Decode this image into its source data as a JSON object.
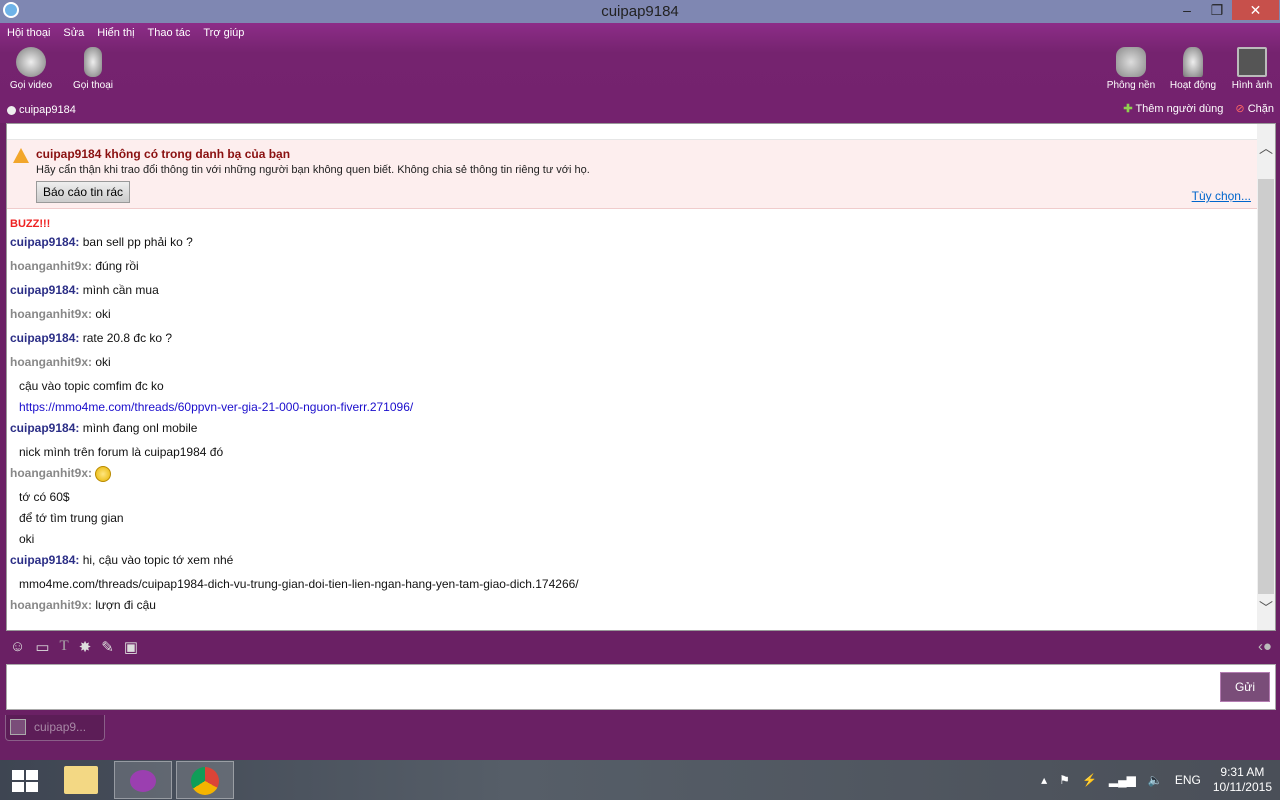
{
  "window": {
    "title": "cuipap9184",
    "min": "–",
    "max": "❐",
    "close": "✕"
  },
  "menu": [
    "Hội thoại",
    "Sửa",
    "Hiển thị",
    "Thao tác",
    "Trợ giúp"
  ],
  "toolbar": {
    "video": "Gọi video",
    "voice": "Gọi thoại",
    "background": "Phông nền",
    "activity": "Hoạt động",
    "photos": "Hình ảnh"
  },
  "contact": {
    "name": "cuipap9184",
    "add_user": "Thêm người dùng",
    "block": "Chặn"
  },
  "warning": {
    "title": "cuipap9184 không có trong danh bạ của bạn",
    "body": "Hãy cẩn thận khi trao đổi thông tin với những người bạn không quen biết. Không chia sẻ thông tin riêng tư với họ.",
    "report": "Báo cáo tin rác",
    "options": "Tùy chọn..."
  },
  "buzz": "BUZZ!!!",
  "messages": [
    {
      "sender": "cuipap9184:",
      "text": "ban sell pp phải ko ?"
    },
    {
      "sender": "hoanganhit9x:",
      "text": "đúng rồi"
    },
    {
      "sender": "cuipap9184:",
      "text": "mình cần mua"
    },
    {
      "sender": "hoanganhit9x:",
      "text": "oki"
    },
    {
      "sender": "cuipap9184:",
      "text": "rate 20.8 đc ko ?"
    },
    {
      "sender": "hoanganhit9x:",
      "text": "oki"
    },
    {
      "text": "cậu vào topic comfim đc ko"
    },
    {
      "link": "https://mmo4me.com/threads/60ppvn-ver-gia-21-000-nguon-fiverr.271096/"
    },
    {
      "sender": "cuipap9184:",
      "text": "mình đang onl mobile"
    },
    {
      "text": "nick mình trên forum là cuipap1984 đó"
    },
    {
      "sender": "hoanganhit9x:",
      "text": ""
    },
    {
      "text": "tớ có 60$"
    },
    {
      "text": "để tớ tìm trung gian"
    },
    {
      "text": "oki"
    },
    {
      "sender": "cuipap9184:",
      "text": "hi, cậu vào topic tớ xem nhé"
    },
    {
      "text": "mmo4me.com/threads/cuipap1984-dich-vu-trung-gian-doi-tien-lien-ngan-hang-yen-tam-giao-dich.174266/"
    },
    {
      "sender": "hoanganhit9x:",
      "text": "lượn đi cậu"
    }
  ],
  "composer": {
    "send": "Gửi",
    "value": ""
  },
  "tab": {
    "label": "cuipap9..."
  },
  "taskbar": {
    "lang": "ENG",
    "time": "9:31 AM",
    "date": "10/11/2015"
  }
}
